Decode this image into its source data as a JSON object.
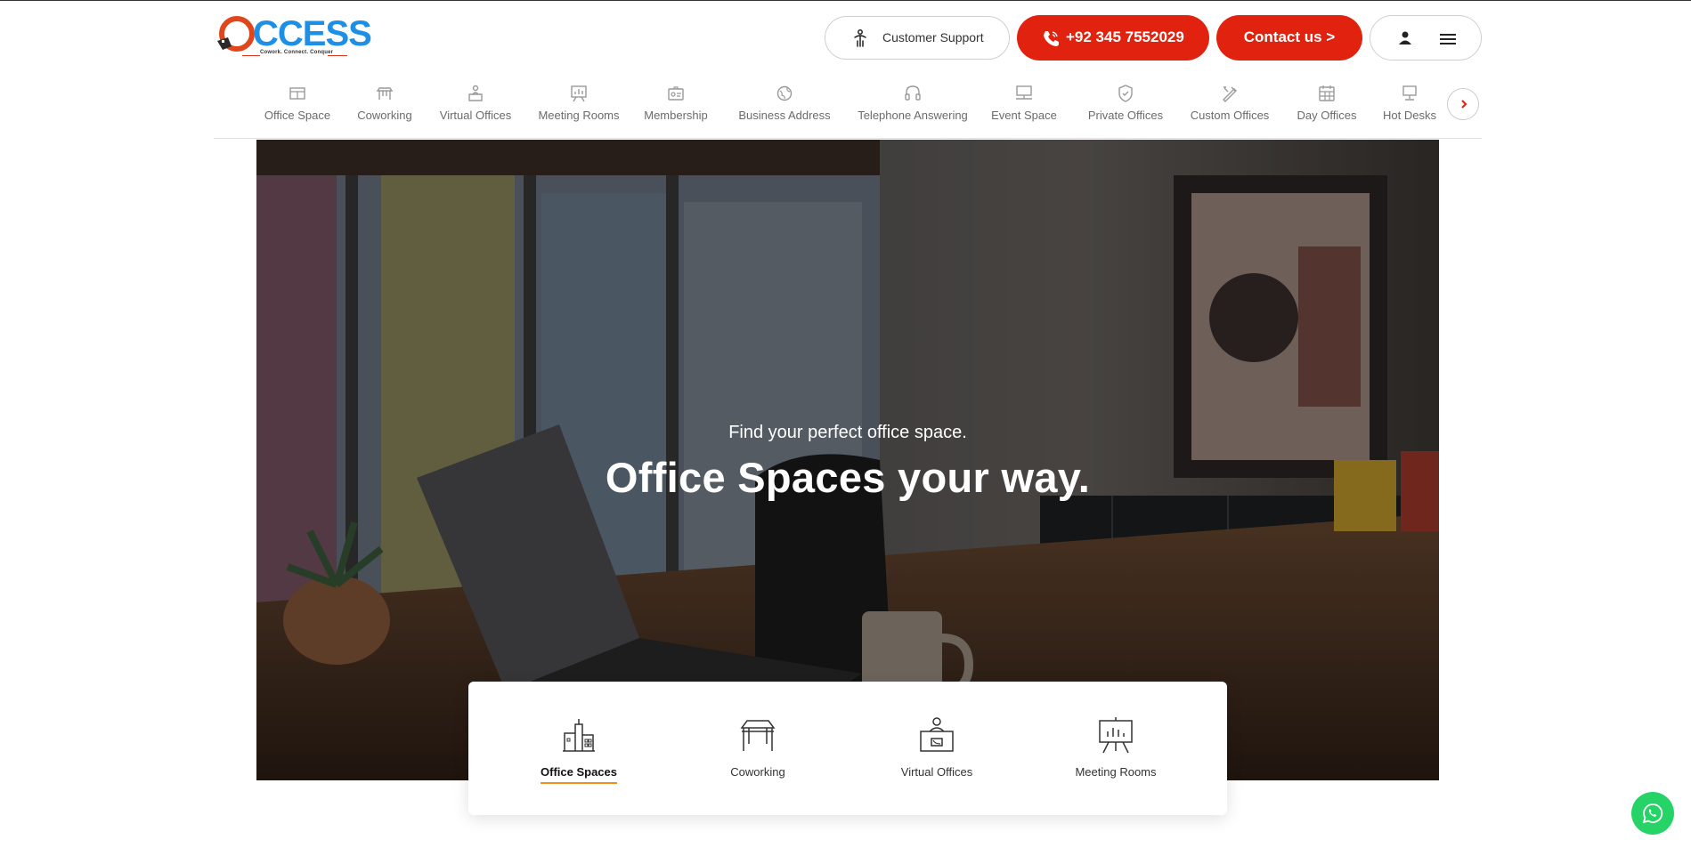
{
  "logo": {
    "word": "CCESS",
    "tagline": "Cowork. Connect. Conquer"
  },
  "header": {
    "support_label": "Customer Support",
    "phone_label": "+92 345 7552029",
    "contact_label": "Contact us >"
  },
  "categories": [
    {
      "label": "Office Space",
      "icon": "office-space-icon"
    },
    {
      "label": "Coworking",
      "icon": "coworking-icon"
    },
    {
      "label": "Virtual Offices",
      "icon": "virtual-offices-icon"
    },
    {
      "label": "Meeting Rooms",
      "icon": "meeting-rooms-icon"
    },
    {
      "label": "Membership",
      "icon": "membership-icon"
    },
    {
      "label": "Business Address",
      "icon": "business-address-icon"
    },
    {
      "label": "Telephone Answering",
      "icon": "telephone-answering-icon"
    },
    {
      "label": "Event Space",
      "icon": "event-space-icon"
    },
    {
      "label": "Private Offices",
      "icon": "private-offices-icon"
    },
    {
      "label": "Custom Offices",
      "icon": "custom-offices-icon"
    },
    {
      "label": "Day Offices",
      "icon": "day-offices-icon"
    },
    {
      "label": "Hot Desks",
      "icon": "hot-desks-icon"
    }
  ],
  "hero": {
    "subtitle": "Find your perfect office space.",
    "title": "Office Spaces your way."
  },
  "search_tabs": [
    {
      "label": "Office Spaces",
      "active": true,
      "icon": "buildings-icon"
    },
    {
      "label": "Coworking",
      "active": false,
      "icon": "desk-icon"
    },
    {
      "label": "Virtual Offices",
      "active": false,
      "icon": "receptionist-icon"
    },
    {
      "label": "Meeting Rooms",
      "active": false,
      "icon": "presentation-board-icon"
    }
  ],
  "colors": {
    "accent": "#e0220e",
    "tab_underline": "#f28c1a",
    "whatsapp": "#25d366",
    "logo_blue": "#1e8fe6"
  }
}
